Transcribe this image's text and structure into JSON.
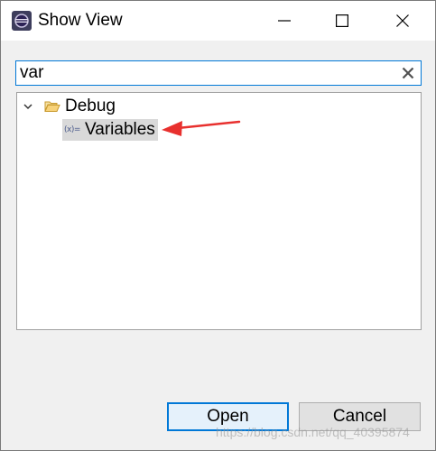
{
  "window": {
    "title": "Show View",
    "app_icon": "eclipse-icon",
    "controls": {
      "minimize_icon": "minimize-icon",
      "maximize_icon": "maximize-icon",
      "close_icon": "close-icon"
    }
  },
  "filter": {
    "value": "var",
    "clear_icon": "clear-icon"
  },
  "tree": {
    "nodes": [
      {
        "label": "Debug",
        "icon": "folder-open-icon",
        "expanded": true,
        "children": [
          {
            "label": "Variables",
            "icon": "variables-icon",
            "icon_text": "(x)=",
            "selected": true
          }
        ]
      }
    ]
  },
  "annotation": {
    "arrow_color": "#e8302e"
  },
  "buttons": {
    "open_label": "Open",
    "cancel_label": "Cancel"
  },
  "watermark": "https://blog.csdn.net/qq_40395874",
  "colors": {
    "focus_blue": "#0078d7",
    "selection_gray": "#d9d9d9",
    "dialog_bg": "#f0f0f0"
  }
}
